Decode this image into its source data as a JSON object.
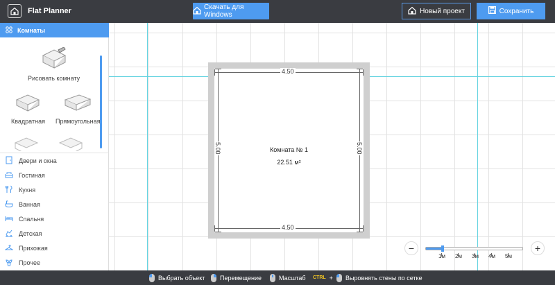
{
  "header": {
    "title": "Flat Planner",
    "download_label": "Скачать для Windows",
    "new_project_label": "Новый проект",
    "save_label": "Сохранить"
  },
  "sidebar": {
    "section_title": "Комнаты",
    "room_tools": [
      {
        "label": "Рисовать комнату",
        "icon": "draw-room-icon"
      },
      {
        "label": "Квадратная",
        "icon": "square-room-icon"
      },
      {
        "label": "Прямоугольная",
        "icon": "rectangular-room-icon"
      }
    ],
    "categories": [
      {
        "label": "Двери и окна",
        "icon": "door-icon"
      },
      {
        "label": "Гостиная",
        "icon": "sofa-icon"
      },
      {
        "label": "Кухня",
        "icon": "kitchen-icon"
      },
      {
        "label": "Ванная",
        "icon": "bathtub-icon"
      },
      {
        "label": "Спальня",
        "icon": "bed-icon"
      },
      {
        "label": "Детская",
        "icon": "toy-icon"
      },
      {
        "label": "Прихожая",
        "icon": "hanger-icon"
      },
      {
        "label": "Прочее",
        "icon": "plant-icon"
      }
    ]
  },
  "room": {
    "name": "Комната №  1",
    "area": "22.51 м²",
    "top_dim": "4.50",
    "bottom_dim": "4.50",
    "left_dim": "5.00",
    "right_dim": "5.00"
  },
  "zoom": {
    "labels": [
      "1м",
      "2м",
      "3м",
      "4м",
      "5м"
    ],
    "level_fraction": 0.17
  },
  "footer": {
    "select_hint": "Выбрать объект",
    "move_hint": "Перемещение",
    "zoom_hint": "Масштаб",
    "ctrl_key": "CTRL",
    "plus": "+",
    "align_hint": "Выровнять стены по сетке"
  },
  "colors": {
    "accent": "#4e9bf0",
    "header_bg": "#3a3c41",
    "guide": "#62d3e0",
    "wall": "#cfcfcf"
  }
}
